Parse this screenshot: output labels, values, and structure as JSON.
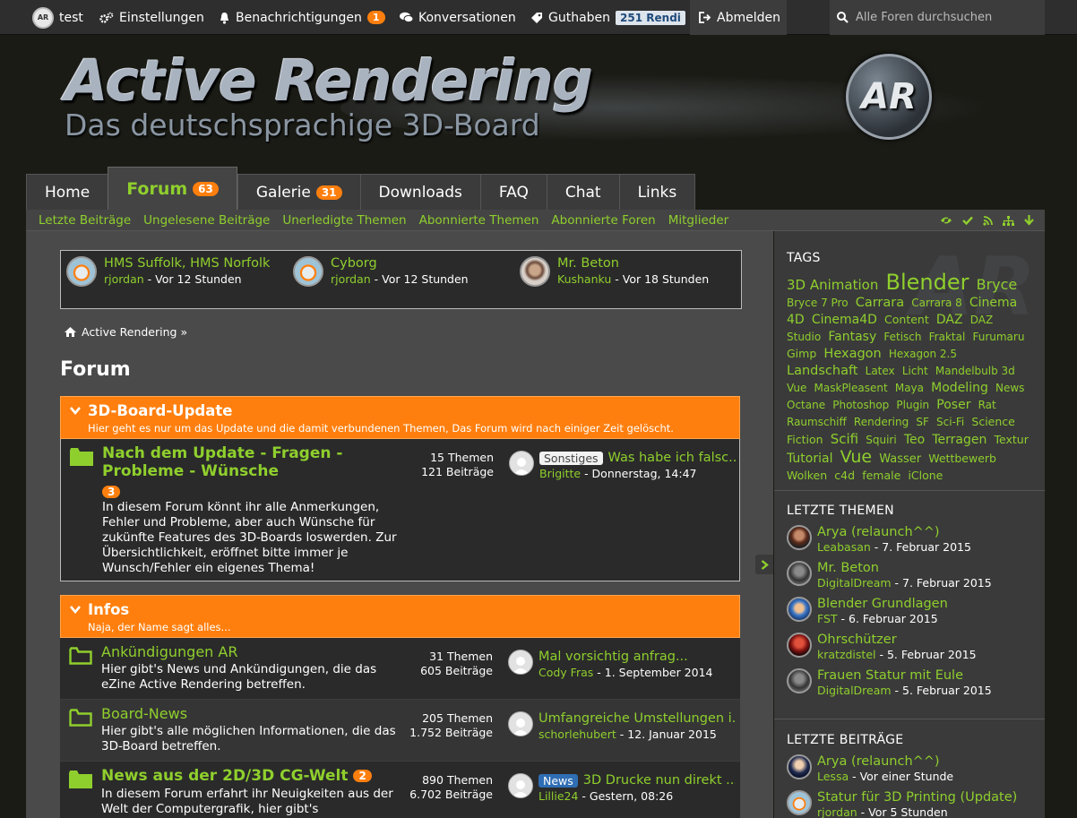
{
  "userbar": {
    "username": "test",
    "settings": "Einstellungen",
    "notifications": "Benachrichtigungen",
    "notifications_count": "1",
    "conversations": "Konversationen",
    "credits": "Guthaben",
    "credits_value": "251 Rendi",
    "logout": "Abmelden",
    "search_placeholder": "Alle Foren durchsuchen"
  },
  "header": {
    "title": "Active Rendering",
    "subtitle": "Das deutschsprachige 3D-Board",
    "emblem": "AR"
  },
  "tabs": [
    {
      "label": "Home",
      "badge": ""
    },
    {
      "label": "Forum",
      "badge": "63",
      "active": true
    },
    {
      "label": "Galerie",
      "badge": "31"
    },
    {
      "label": "Downloads",
      "badge": ""
    },
    {
      "label": "FAQ",
      "badge": ""
    },
    {
      "label": "Chat",
      "badge": ""
    },
    {
      "label": "Links",
      "badge": ""
    }
  ],
  "subnav": [
    "Letzte Beiträge",
    "Ungelesene Beiträge",
    "Unerledigte Themen",
    "Abonnierte Themen",
    "Abonnierte Foren",
    "Mitglieder"
  ],
  "recent": [
    {
      "title": "HMS Suffolk, HMS Norfolk",
      "user": "rjordan",
      "time": " - Vor 12 Stunden"
    },
    {
      "title": "Cyborg",
      "user": "rjordan",
      "time": " - Vor 12 Stunden"
    },
    {
      "title": "Mr. Beton",
      "user": "Kushanku",
      "time": " - Vor 18 Stunden"
    }
  ],
  "breadcrumb": "Active Rendering »",
  "page_title": "Forum",
  "categories": [
    {
      "title": "3D-Board-Update",
      "desc": "Hier geht es nur um das Update und die damit verbundenen Themen, Das Forum wird nach einiger Zeit gelöscht.",
      "forums": [
        {
          "name": "Nach dem Update - Fragen - Probleme - Wünsche",
          "badge": "3",
          "desc": "In diesem Forum könnt ihr alle Anmerkungen, Fehler und Probleme, aber auch Wünsche für zukünfte Features des 3D-Boards loswerden. Zur Übersichtlichkeit, eröffnet bitte immer je Wunsch/Fehler ein eigenes Thema!",
          "themes": "15",
          "posts": "121",
          "prefix": "Sonstiges",
          "last_title": "Was habe ich falsc...",
          "last_user": "Brigitte",
          "last_time": " - Donnerstag, 14:47"
        }
      ]
    },
    {
      "title": "Infos",
      "desc": "Naja, der Name sagt alles...",
      "forums": [
        {
          "name": "Ankündigungen AR",
          "badge": "",
          "desc": "Hier gibt's News und Ankündigungen, die das eZine Active Rendering betreffen.",
          "themes": "31",
          "posts": "605",
          "prefix": "",
          "last_title": "Mal vorsichtig anfrag...",
          "last_user": "Cody Fras",
          "last_time": " - 1. September 2014"
        },
        {
          "name": "Board-News",
          "badge": "",
          "desc": "Hier gibt's alle möglichen Informationen, die das 3D-Board betreffen.",
          "themes": "205",
          "posts": "1.752",
          "prefix": "",
          "last_title": "Umfangreiche Umstellungen i...",
          "last_user": "schorlehubert",
          "last_time": " - 12. Januar 2015"
        },
        {
          "name": "News aus der 2D/3D CG-Welt",
          "badge": "2",
          "desc": "In diesem Forum erfahrt ihr Neuigkeiten aus der Welt der Computergrafik, hier gibt's",
          "themes": "890",
          "posts": "6.702",
          "prefix": "News",
          "last_title": "3D Drucke nun direkt ...",
          "last_user": "Lillie24",
          "last_time": " - Gestern, 08:26"
        }
      ]
    }
  ],
  "labels": {
    "themes": "Themen",
    "posts": "Beiträge"
  },
  "sidebar": {
    "tags_head": "TAGS",
    "tags": [
      {
        "t": "3D Animation",
        "s": 15
      },
      {
        "t": "Blender",
        "s": 24
      },
      {
        "t": "Bryce",
        "s": 16
      },
      {
        "t": "Bryce 7 Pro",
        "s": 12
      },
      {
        "t": "Carrara",
        "s": 14.5
      },
      {
        "t": "Carrara 8",
        "s": 12
      },
      {
        "t": "Cinema 4D",
        "s": 14
      },
      {
        "t": "Cinema4D",
        "s": 14
      },
      {
        "t": "Content",
        "s": 12.5
      },
      {
        "t": "DAZ",
        "s": 14
      },
      {
        "t": "DAZ Studio",
        "s": 12
      },
      {
        "t": "Fantasy",
        "s": 14
      },
      {
        "t": "Fetisch",
        "s": 12
      },
      {
        "t": "Fraktal",
        "s": 12
      },
      {
        "t": "Furumaru",
        "s": 12
      },
      {
        "t": "Gimp",
        "s": 12.5
      },
      {
        "t": "Hexagon",
        "s": 14.5
      },
      {
        "t": "Hexagon 2.5",
        "s": 12
      },
      {
        "t": "Landschaft",
        "s": 14.5
      },
      {
        "t": "Latex",
        "s": 12
      },
      {
        "t": "Licht",
        "s": 12
      },
      {
        "t": "Mandelbulb 3d",
        "s": 12
      },
      {
        "t": "Vue",
        "s": 12
      },
      {
        "t": "MaskPleasent",
        "s": 12
      },
      {
        "t": "Maya",
        "s": 12
      },
      {
        "t": "Modeling",
        "s": 14
      },
      {
        "t": "News",
        "s": 12
      },
      {
        "t": "Octane",
        "s": 12
      },
      {
        "t": "Photoshop",
        "s": 12
      },
      {
        "t": "Plugin",
        "s": 12
      },
      {
        "t": "Poser",
        "s": 14
      },
      {
        "t": "Rat",
        "s": 12
      },
      {
        "t": "Raumschiff",
        "s": 12
      },
      {
        "t": "Rendering",
        "s": 12
      },
      {
        "t": "SF",
        "s": 12
      },
      {
        "t": "Sci-Fi",
        "s": 12
      },
      {
        "t": "Science Fiction",
        "s": 12.5
      },
      {
        "t": "Scifi",
        "s": 15
      },
      {
        "t": "Squiri",
        "s": 12
      },
      {
        "t": "Teo",
        "s": 14
      },
      {
        "t": "Terragen",
        "s": 14
      },
      {
        "t": "Textur",
        "s": 12.5
      },
      {
        "t": "Tutorial",
        "s": 14
      },
      {
        "t": "Vue",
        "s": 19
      },
      {
        "t": "Wasser",
        "s": 13
      },
      {
        "t": "Wettbewerb",
        "s": 12.5
      },
      {
        "t": "Wolken",
        "s": 12.5
      },
      {
        "t": "c4d",
        "s": 12.5
      },
      {
        "t": "female",
        "s": 12.5
      },
      {
        "t": "iClone",
        "s": 12.5
      }
    ],
    "latest_threads_head": "LETZTE THEMEN",
    "latest_threads": [
      {
        "title": "Arya (relaunch^^)",
        "user": "Leabasan",
        "time": " - 7. Februar 2015"
      },
      {
        "title": "Mr. Beton",
        "user": "DigitalDream",
        "time": " - 7. Februar 2015"
      },
      {
        "title": "Blender Grundlagen",
        "user": "FST",
        "time": " - 6. Februar 2015"
      },
      {
        "title": "Ohrschützer",
        "user": "kratzdistel",
        "time": " - 5. Februar 2015"
      },
      {
        "title": "Frauen Statur mit Eule",
        "user": "DigitalDream",
        "time": " - 5. Februar 2015"
      }
    ],
    "latest_posts_head": "LETZTE BEITRÄGE",
    "latest_posts": [
      {
        "title": "Arya (relaunch^^)",
        "user": "Lessa",
        "time": " - Vor einer Stunde"
      },
      {
        "title": "Statur für 3D Printing (Update)",
        "user": "rjordan",
        "time": " - Vor 5 Stunden"
      }
    ]
  }
}
